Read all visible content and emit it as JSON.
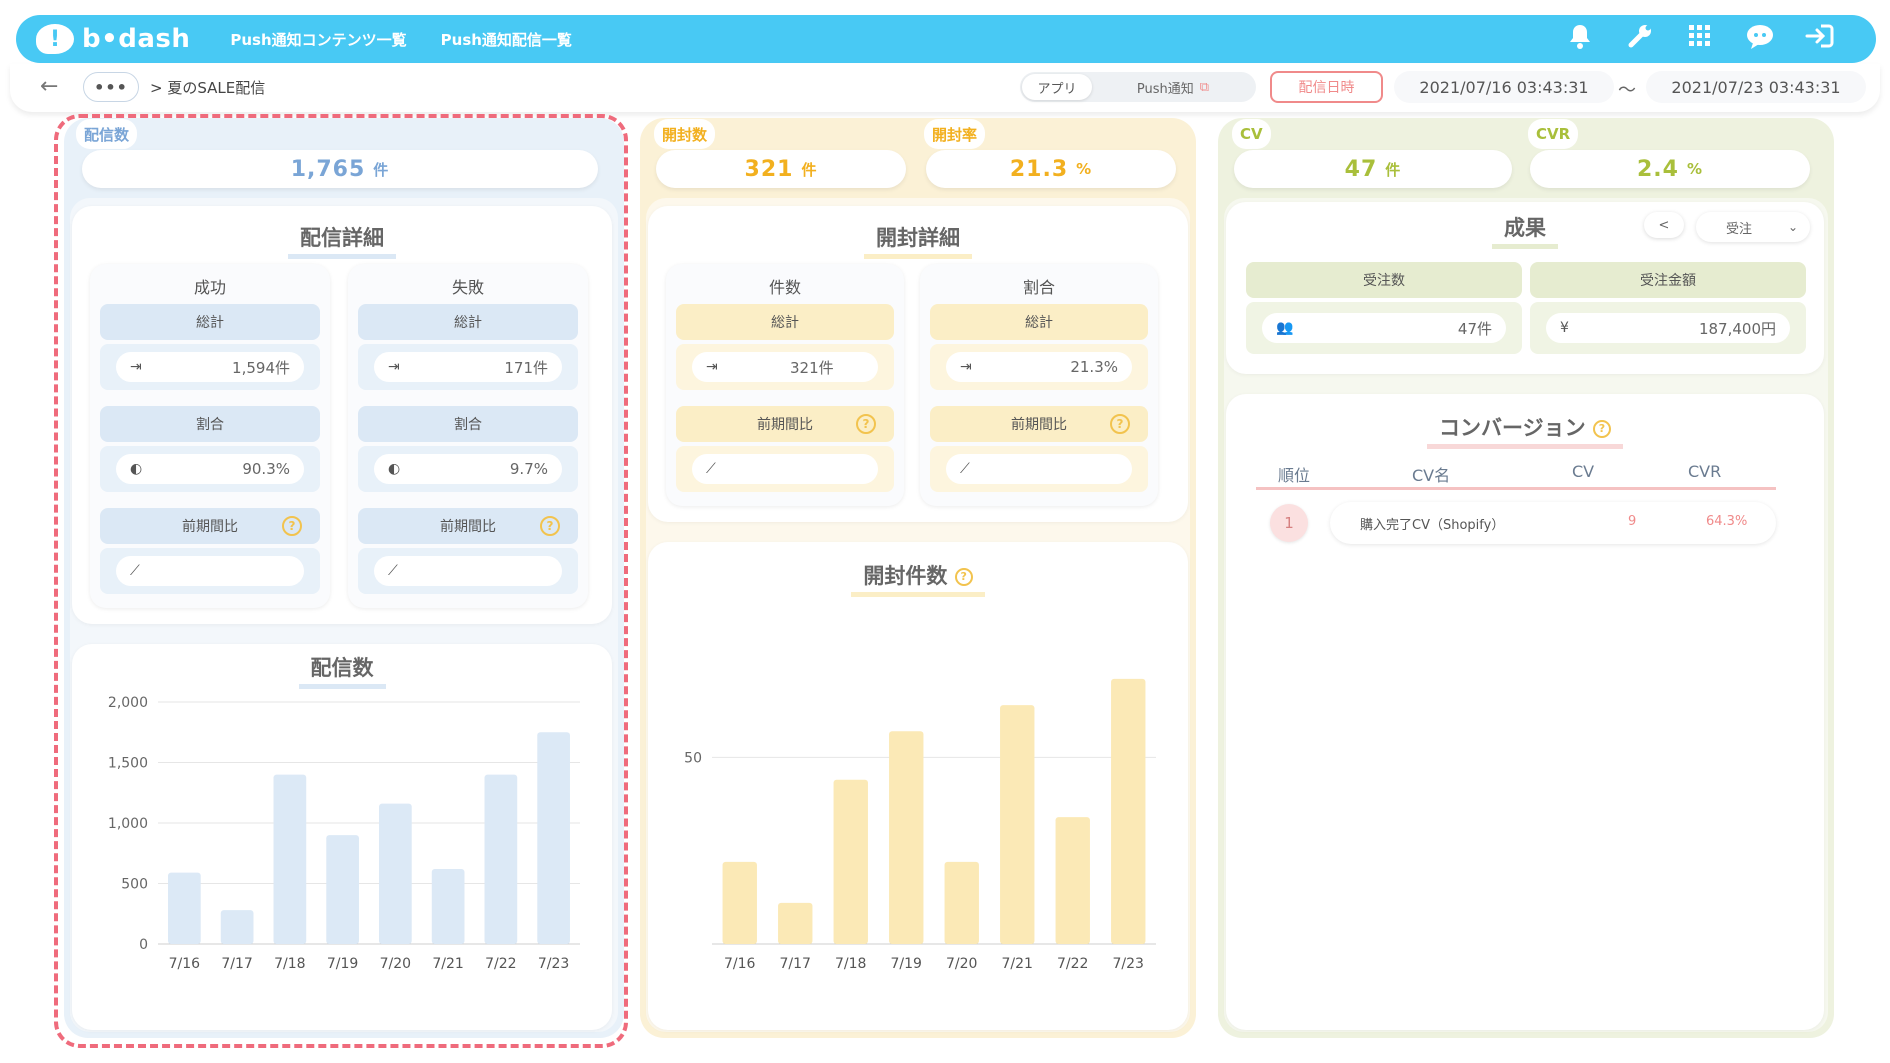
{
  "app": {
    "logo_text": "b•dash",
    "nav": [
      "Push通知コンテンツ一覧",
      "Push通知配信一覧"
    ]
  },
  "toolbar": {
    "back": "←",
    "more": "•••",
    "breadcrumb": "> 夏のSALE配信",
    "segment": [
      "アプリ",
      "Push通知"
    ],
    "date_button": "配信日時",
    "date_from": "2021/07/16 03:43:31",
    "separator": "〜",
    "date_to": "2021/07/23 03:43:31"
  },
  "colors": {
    "header": "#48c9f4",
    "blue": "#7aa5d6",
    "yellow": "#f2b01f",
    "green": "#a9bf3b",
    "highlight": "#ef6b7c",
    "blue_bar": "#dce9f6",
    "yellow_bar": "#fbe9b6"
  },
  "kpi": {
    "deliveries": {
      "label": "配信数",
      "value": "1,765",
      "unit": "件"
    },
    "opens": {
      "label": "開封数",
      "value": "321",
      "unit": "件"
    },
    "open_rate": {
      "label": "開封率",
      "value": "21.3",
      "unit": "%"
    },
    "cv": {
      "label": "CV",
      "value": "47",
      "unit": "件"
    },
    "cvr": {
      "label": "CVR",
      "value": "2.4",
      "unit": "%"
    }
  },
  "delivery_detail": {
    "title": "配信詳細",
    "success": {
      "title": "成功",
      "total_label": "総計",
      "total": "1,594件",
      "ratio_label": "割合",
      "ratio": "90.3%",
      "compare_label": "前期間比"
    },
    "failure": {
      "title": "失敗",
      "total_label": "総計",
      "total": "171件",
      "ratio_label": "割合",
      "ratio": "9.7%",
      "compare_label": "前期間比"
    }
  },
  "open_detail": {
    "title": "開封詳細",
    "count": {
      "title": "件数",
      "total_label": "総計",
      "total": "321件",
      "compare_label": "前期間比"
    },
    "rate": {
      "title": "割合",
      "total_label": "総計",
      "total": "21.3%",
      "compare_label": "前期間比"
    }
  },
  "results": {
    "title": "成果",
    "select": "受注",
    "orders_label": "受注数",
    "amount_label": "受注金額",
    "orders": "47件",
    "amount": "187,400円"
  },
  "conversion": {
    "title": "コンバージョン",
    "headers": [
      "順位",
      "CV名",
      "CV",
      "CVR"
    ],
    "rows": [
      {
        "rank": "1",
        "name": "購入完了CV（Shopify）",
        "cv": "9",
        "cvr": "64.3%"
      }
    ]
  },
  "chart_data": [
    {
      "type": "bar",
      "title": "配信数",
      "categories": [
        "7/16",
        "7/17",
        "7/18",
        "7/19",
        "7/20",
        "7/21",
        "7/22",
        "7/23"
      ],
      "values": [
        590,
        280,
        1400,
        900,
        1160,
        620,
        1400,
        1750
      ],
      "ylim": [
        0,
        2000
      ],
      "yticks": [
        "0",
        "500",
        "1,000",
        "1,500",
        "2,000"
      ],
      "grid": true
    },
    {
      "type": "bar",
      "title": "開封件数",
      "categories": [
        "7/16",
        "7/17",
        "7/18",
        "7/19",
        "7/20",
        "7/21",
        "7/22",
        "7/23"
      ],
      "values": [
        22,
        11,
        44,
        57,
        22,
        64,
        34,
        71
      ],
      "ylim": [
        0,
        75
      ],
      "yticks": [
        "50"
      ],
      "grid": true
    }
  ]
}
